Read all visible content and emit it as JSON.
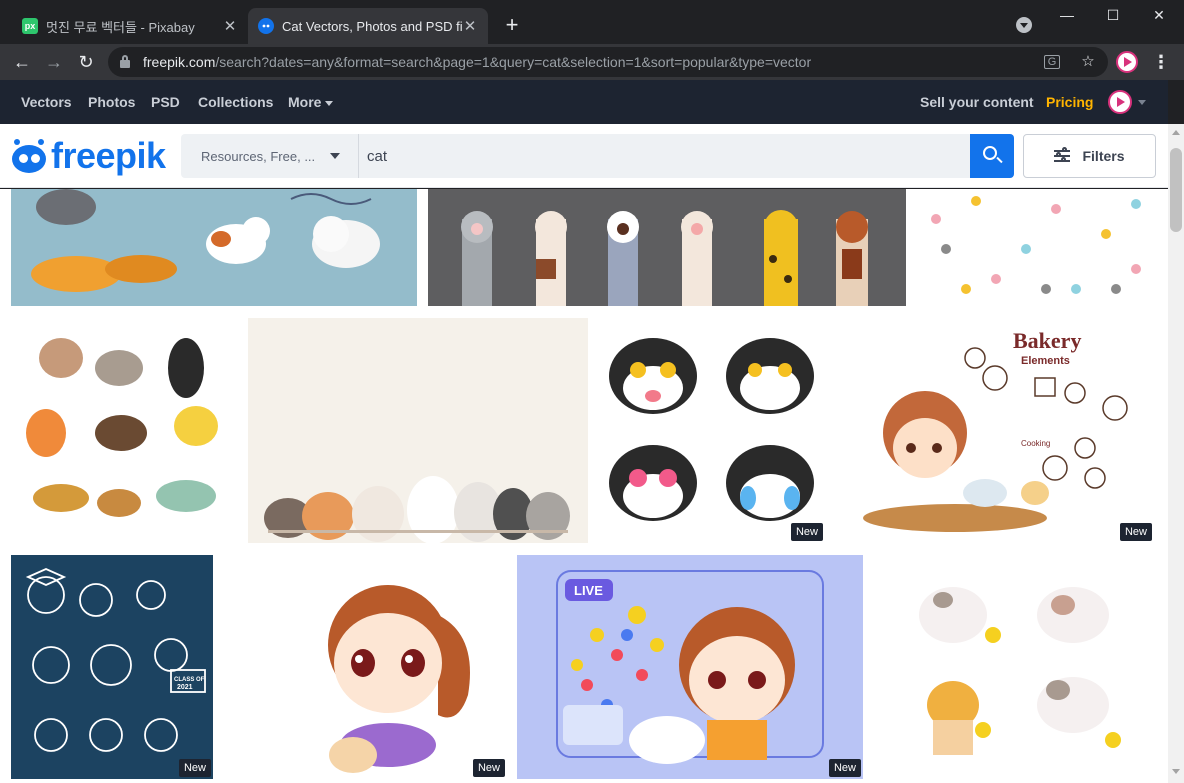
{
  "browser": {
    "tabs": [
      {
        "favicon": "px",
        "title": "멋진 무료 벡터들 - Pixabay",
        "active": false
      },
      {
        "favicon": "freepik-icon",
        "title": "Cat Vectors, Photos and PSD files",
        "active": true
      }
    ],
    "new_tab_label": "+",
    "url_host": "freepik.com",
    "url_path": "/search?dates=any&format=search&page=1&query=cat&selection=1&sort=popular&type=vector"
  },
  "nav": {
    "vectors": "Vectors",
    "photos": "Photos",
    "psd": "PSD",
    "collections": "Collections",
    "more": "More",
    "sell": "Sell your content",
    "pricing": "Pricing"
  },
  "search": {
    "logo_text": "freepik",
    "resource_type": "Resources, Free, ...",
    "query": "cat",
    "filters_label": "Filters"
  },
  "results": [
    {
      "subject": "cats playing with yarn",
      "badge": ""
    },
    {
      "subject": "cat paws raised",
      "badge": ""
    },
    {
      "subject": "paw print pattern",
      "badge": ""
    },
    {
      "subject": "cartoon cats set",
      "badge": ""
    },
    {
      "subject": "row of cats",
      "badge": ""
    },
    {
      "subject": "cat emoticon stickers",
      "badge": "New"
    },
    {
      "subject": "girl baking with cat",
      "badge": "New"
    },
    {
      "subject": "graduation animals line art",
      "badge": "New"
    },
    {
      "subject": "girl hugging kitten",
      "badge": "New"
    },
    {
      "subject": "live stream girl with cat",
      "badge": "New"
    },
    {
      "subject": "kawaii cat stickers",
      "badge": ""
    }
  ],
  "thumb_text": {
    "bakery_title": "Bakery",
    "bakery_sub": "Elements",
    "cooking": "Cooking",
    "live": "LIVE",
    "class_of": "CLASS OF",
    "class_year": "2021"
  },
  "colors": {
    "brand": "#1273eb",
    "pricing": "#ffb400",
    "nav_bg": "#1d2431"
  }
}
